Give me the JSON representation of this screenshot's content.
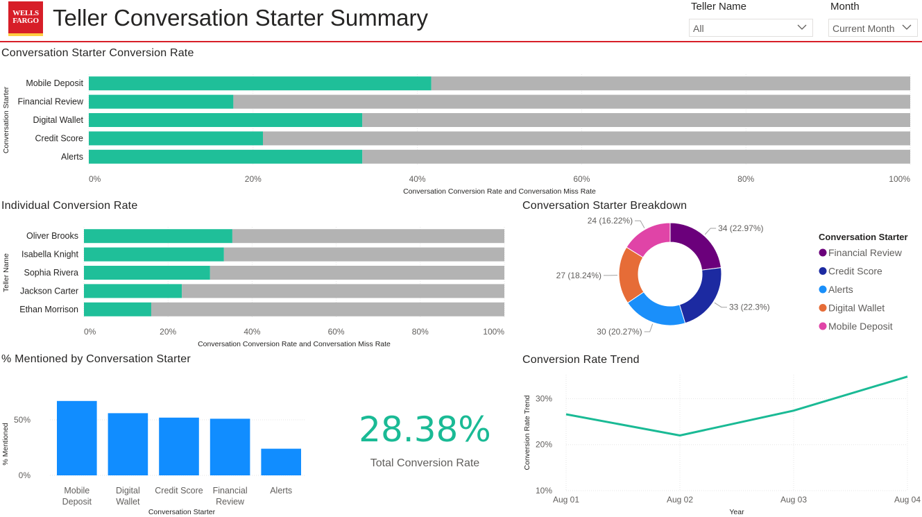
{
  "header": {
    "logo_text": "WELLS FARGO",
    "title": "Teller Conversation Starter Summary",
    "brand_color": "#d71e28",
    "logo_accent": "#ffcd41"
  },
  "filters": {
    "teller": {
      "label": "Teller Name",
      "value": "All",
      "icon": "chevron-down-icon"
    },
    "month": {
      "label": "Month",
      "value": "Current Month",
      "icon": "chevron-down-icon"
    }
  },
  "sections": {
    "starter_conversion": "Conversation Starter Conversion Rate",
    "individual_conversion": "Individual Conversion Rate",
    "breakdown": "Conversation Starter Breakdown",
    "mentioned": "% Mentioned by Conversation Starter",
    "trend": "Conversion Rate Trend"
  },
  "kpi": {
    "value": "28.38%",
    "label": "Total Conversion Rate",
    "color": "#1aba95"
  },
  "colors": {
    "conversion": "#1fbf99",
    "miss": "#b3b3b3",
    "bar": "#118dff",
    "trend_line": "#1aba95"
  },
  "chart_data": [
    {
      "id": "starter_conversion",
      "type": "bar",
      "orientation": "horizontal",
      "stacked": "100%",
      "categories": [
        "Mobile Deposit",
        "Financial Review",
        "Digital Wallet",
        "Credit Score",
        "Alerts"
      ],
      "series": [
        {
          "values": [
            41.7,
            17.6,
            33.3,
            21.2,
            33.3
          ],
          "color": "#1fbf99"
        },
        {
          "values": [
            58.3,
            82.4,
            66.7,
            78.8,
            66.7
          ],
          "color": "#b3b3b3"
        }
      ],
      "xticks": [
        "0%",
        "20%",
        "40%",
        "60%",
        "80%",
        "100%"
      ],
      "xlabel": "Conversation Conversion Rate and Conversation Miss Rate",
      "ylabel": "Conversation Starter",
      "xlim": [
        0,
        100
      ],
      "grid": true
    },
    {
      "id": "individual_conversion",
      "type": "bar",
      "orientation": "horizontal",
      "stacked": "100%",
      "categories": [
        "Oliver Brooks",
        "Isabella Knight",
        "Sophia Rivera",
        "Jackson Carter",
        "Ethan Morrison"
      ],
      "series": [
        {
          "values": [
            35.3,
            33.3,
            30.0,
            23.3,
            16.0
          ],
          "color": "#1fbf99"
        },
        {
          "values": [
            64.7,
            66.7,
            70.0,
            76.7,
            84.0
          ],
          "color": "#b3b3b3"
        }
      ],
      "xticks": [
        "0%",
        "20%",
        "40%",
        "60%",
        "80%",
        "100%"
      ],
      "xlabel": "Conversation Conversion Rate and Conversation Miss Rate",
      "ylabel": "Teller Name",
      "xlim": [
        0,
        100
      ],
      "grid": true
    },
    {
      "id": "breakdown",
      "type": "pie",
      "donut": true,
      "legend_title": "Conversation Starter",
      "legend_position": "right",
      "slices": [
        {
          "label": "Financial Review",
          "value": 34,
          "data_label": "34 (22.97%)",
          "color": "#6b007b"
        },
        {
          "label": "Credit Score",
          "value": 33,
          "data_label": "33 (22.3%)",
          "color": "#1c2aa1"
        },
        {
          "label": "Alerts",
          "value": 30,
          "data_label": "30 (20.27%)",
          "color": "#1a8ffa"
        },
        {
          "label": "Digital Wallet",
          "value": 27,
          "data_label": "27 (18.24%)",
          "color": "#e66c37"
        },
        {
          "label": "Mobile Deposit",
          "value": 24,
          "data_label": "24 (16.22%)",
          "color": "#e044a7"
        }
      ]
    },
    {
      "id": "mentioned",
      "type": "bar",
      "orientation": "vertical",
      "categories": [
        [
          "Mobile",
          "Deposit"
        ],
        [
          "Digital",
          "Wallet"
        ],
        [
          "Credit Score"
        ],
        [
          "Financial",
          "Review"
        ],
        [
          "Alerts"
        ]
      ],
      "values": [
        67,
        56,
        52,
        51,
        24
      ],
      "color": "#118dff",
      "yticks": [
        "0%",
        "50%"
      ],
      "ylim": [
        0,
        75
      ],
      "ylabel": "% Mentioned",
      "xlabel": "Conversation Starter",
      "grid": true
    },
    {
      "id": "trend",
      "type": "line",
      "x": [
        "Aug 01",
        "Aug 02",
        "Aug 03",
        "Aug 04"
      ],
      "values": [
        26.6,
        22.0,
        27.4,
        34.8
      ],
      "color": "#1aba95",
      "yticks": [
        "10%",
        "20%",
        "30%"
      ],
      "ylim": [
        10,
        35.2
      ],
      "ylabel": "Conversion Rate Trend",
      "xlabel": "Year",
      "grid": true
    }
  ]
}
